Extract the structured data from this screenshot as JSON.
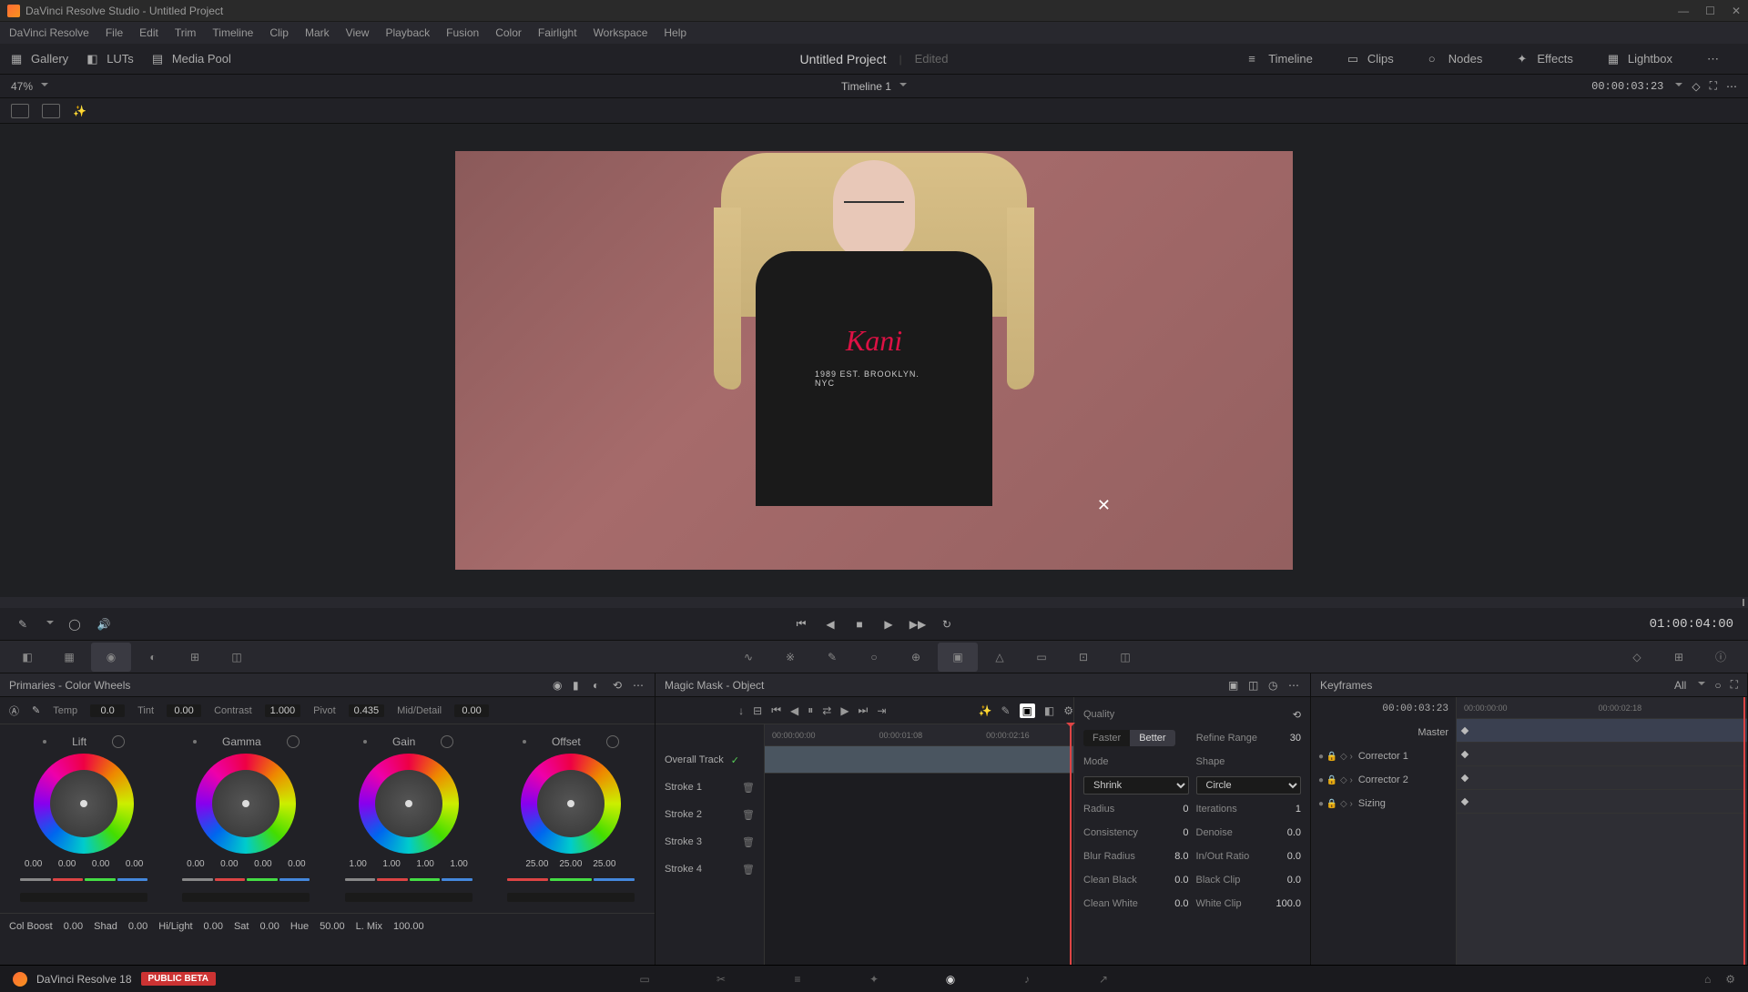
{
  "titlebar": {
    "title": "DaVinci Resolve Studio - Untitled Project"
  },
  "menu": {
    "items": [
      "DaVinci Resolve",
      "File",
      "Edit",
      "Trim",
      "Timeline",
      "Clip",
      "Mark",
      "View",
      "Playback",
      "Fusion",
      "Color",
      "Fairlight",
      "Workspace",
      "Help"
    ]
  },
  "toolbar": {
    "left": [
      {
        "label": "Gallery",
        "icon": "gallery-icon"
      },
      {
        "label": "LUTs",
        "icon": "luts-icon"
      },
      {
        "label": "Media Pool",
        "icon": "media-pool-icon"
      }
    ],
    "project": "Untitled Project",
    "status": "Edited",
    "right": [
      {
        "label": "Timeline",
        "icon": "timeline-icon"
      },
      {
        "label": "Clips",
        "icon": "clips-icon"
      },
      {
        "label": "Nodes",
        "icon": "nodes-icon"
      },
      {
        "label": "Effects",
        "icon": "effects-icon"
      },
      {
        "label": "Lightbox",
        "icon": "lightbox-icon"
      }
    ]
  },
  "subheader": {
    "zoom": "47%",
    "timeline": "Timeline 1",
    "timecode": "00:00:03:23"
  },
  "viewer": {
    "tshirt_logo": "Kani",
    "tshirt_text": "1989 EST. BROOKLYN. NYC"
  },
  "transport": {
    "timecode": "01:00:04:00"
  },
  "primaries": {
    "title": "Primaries - Color Wheels",
    "top": {
      "temp_l": "Temp",
      "temp": "0.0",
      "tint_l": "Tint",
      "tint": "0.00",
      "contrast_l": "Contrast",
      "contrast": "1.000",
      "pivot_l": "Pivot",
      "pivot": "0.435",
      "md_l": "Mid/Detail",
      "md": "0.00"
    },
    "wheels": [
      {
        "name": "Lift",
        "vals": [
          "0.00",
          "0.00",
          "0.00",
          "0.00"
        ]
      },
      {
        "name": "Gamma",
        "vals": [
          "0.00",
          "0.00",
          "0.00",
          "0.00"
        ]
      },
      {
        "name": "Gain",
        "vals": [
          "1.00",
          "1.00",
          "1.00",
          "1.00"
        ]
      },
      {
        "name": "Offset",
        "vals": [
          "25.00",
          "25.00",
          "25.00"
        ]
      }
    ],
    "bottom": {
      "colboost_l": "Col Boost",
      "colboost": "0.00",
      "shad_l": "Shad",
      "shad": "0.00",
      "hilight_l": "Hi/Light",
      "hilight": "0.00",
      "sat_l": "Sat",
      "sat": "0.00",
      "hue_l": "Hue",
      "hue": "50.00",
      "lmix_l": "L. Mix",
      "lmix": "100.00"
    }
  },
  "magicmask": {
    "title": "Magic Mask - Object",
    "strokes": [
      "Overall Track",
      "Stroke 1",
      "Stroke 2",
      "Stroke 3",
      "Stroke 4"
    ],
    "ruler": [
      "00:00:00:00",
      "00:00:01:08",
      "00:00:02:16"
    ],
    "quality": "Quality",
    "faster": "Faster",
    "better": "Better",
    "refine_l": "Refine Range",
    "refine": "30",
    "mode_l": "Mode",
    "shape_l": "Shape",
    "mode": "Shrink",
    "shape": "Circle",
    "radius_l": "Radius",
    "radius": "0",
    "iter_l": "Iterations",
    "iter": "1",
    "cons_l": "Consistency",
    "cons": "0",
    "denoise_l": "Denoise",
    "denoise": "0.0",
    "blur_l": "Blur Radius",
    "blur": "8.0",
    "inout_l": "In/Out Ratio",
    "inout": "0.0",
    "cblack_l": "Clean Black",
    "cblack": "0.0",
    "bclip_l": "Black Clip",
    "bclip": "0.0",
    "cwhite_l": "Clean White",
    "cwhite": "0.0",
    "wclip_l": "White Clip",
    "wclip": "100.0"
  },
  "keyframes": {
    "title": "Keyframes",
    "all": "All",
    "timecode": "00:00:03:23",
    "ruler": [
      "00:00:00:00",
      "00:00:02:18"
    ],
    "items": [
      "Master",
      "Corrector 1",
      "Corrector 2",
      "Sizing"
    ]
  },
  "footer": {
    "app": "DaVinci Resolve 18",
    "badge": "PUBLIC BETA"
  }
}
